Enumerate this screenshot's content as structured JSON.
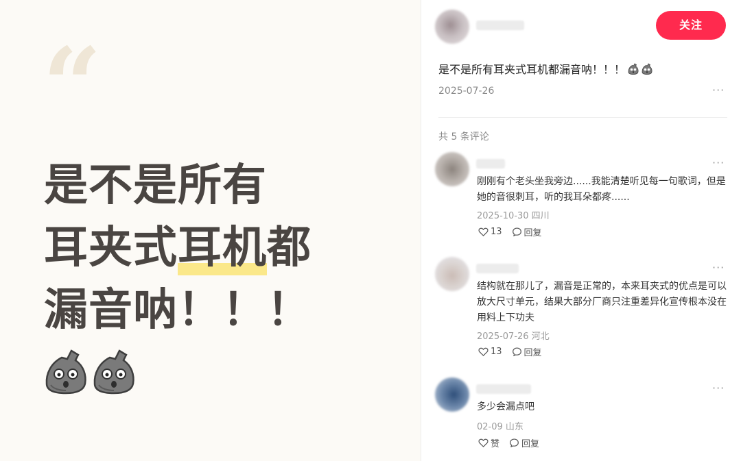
{
  "image": {
    "headline_line1": "是不是所有",
    "headline_line2a": "耳夹式",
    "headline_line2b": "耳机",
    "headline_line2c": "都",
    "headline_line3": "漏音呐！！！",
    "quote_mark": "“"
  },
  "post": {
    "follow_label": "关注",
    "title": "是不是所有耳夹式耳机都漏音呐！！！",
    "date": "2025-07-26",
    "more": "···",
    "comment_count": "共 5 条评论"
  },
  "comments": [
    {
      "text": "刚刚有个老头坐我旁边......我能清楚听见每一句歌词，但是她的音很刺耳，听的我耳朵都疼......",
      "meta": "2025-10-30 四川",
      "likes": "13",
      "reply": "回复",
      "more": "···"
    },
    {
      "text": "结构就在那儿了，漏音是正常的，本来耳夹式的优点是可以放大尺寸单元，结果大部分厂商只注重差异化宣传根本没在用料上下功夫",
      "meta": "2025-07-26 河北",
      "likes": "13",
      "reply": "回复",
      "more": "···"
    },
    {
      "text": "多少会漏点吧",
      "meta": "02-09 山东",
      "likes": "赞",
      "reply": "回复",
      "more": "···"
    }
  ],
  "colors": {
    "accent": "#ff2a4e",
    "highlight": "#fbe88a",
    "headline": "#4a4542"
  },
  "icons": [
    "heart-icon",
    "comment-bubble-icon",
    "more-icon",
    "stone-emoji-icon"
  ]
}
